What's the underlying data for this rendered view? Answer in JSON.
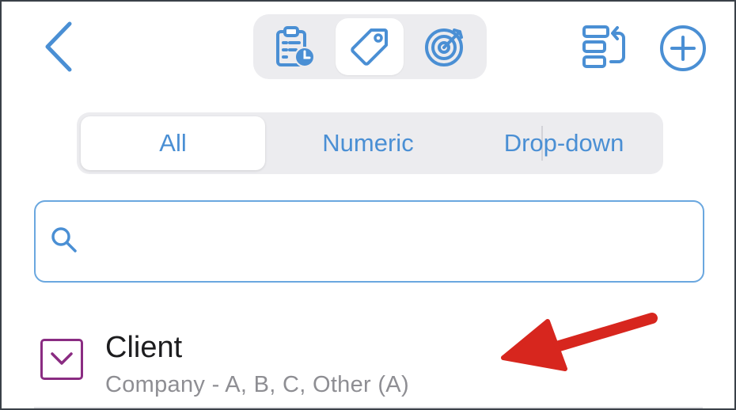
{
  "header": {
    "back_icon": "chevron-left-icon",
    "tab_icons": [
      {
        "icon": "clipboard-clock-icon",
        "active": false
      },
      {
        "icon": "tag-icon",
        "active": true
      },
      {
        "icon": "target-icon",
        "active": false
      }
    ],
    "sort_icon": "reorder-icon",
    "add_icon": "plus-circle-icon"
  },
  "filter": {
    "segments": [
      "All",
      "Numeric",
      "Drop-down"
    ],
    "selected": "All"
  },
  "search": {
    "value": "",
    "placeholder": ""
  },
  "list": {
    "items": [
      {
        "title": "Client",
        "subtitle": "Company - A, B, C, Other (A)",
        "icon": "dropdown-chevron-icon",
        "icon_color": "#8a2c82"
      }
    ]
  },
  "annotation": {
    "type": "arrow",
    "color": "#d7261e",
    "points_to": "list-item-client"
  },
  "colors": {
    "accent": "#4a8fd4",
    "segment_bg": "#ececef",
    "search_border": "#6aa7df"
  }
}
